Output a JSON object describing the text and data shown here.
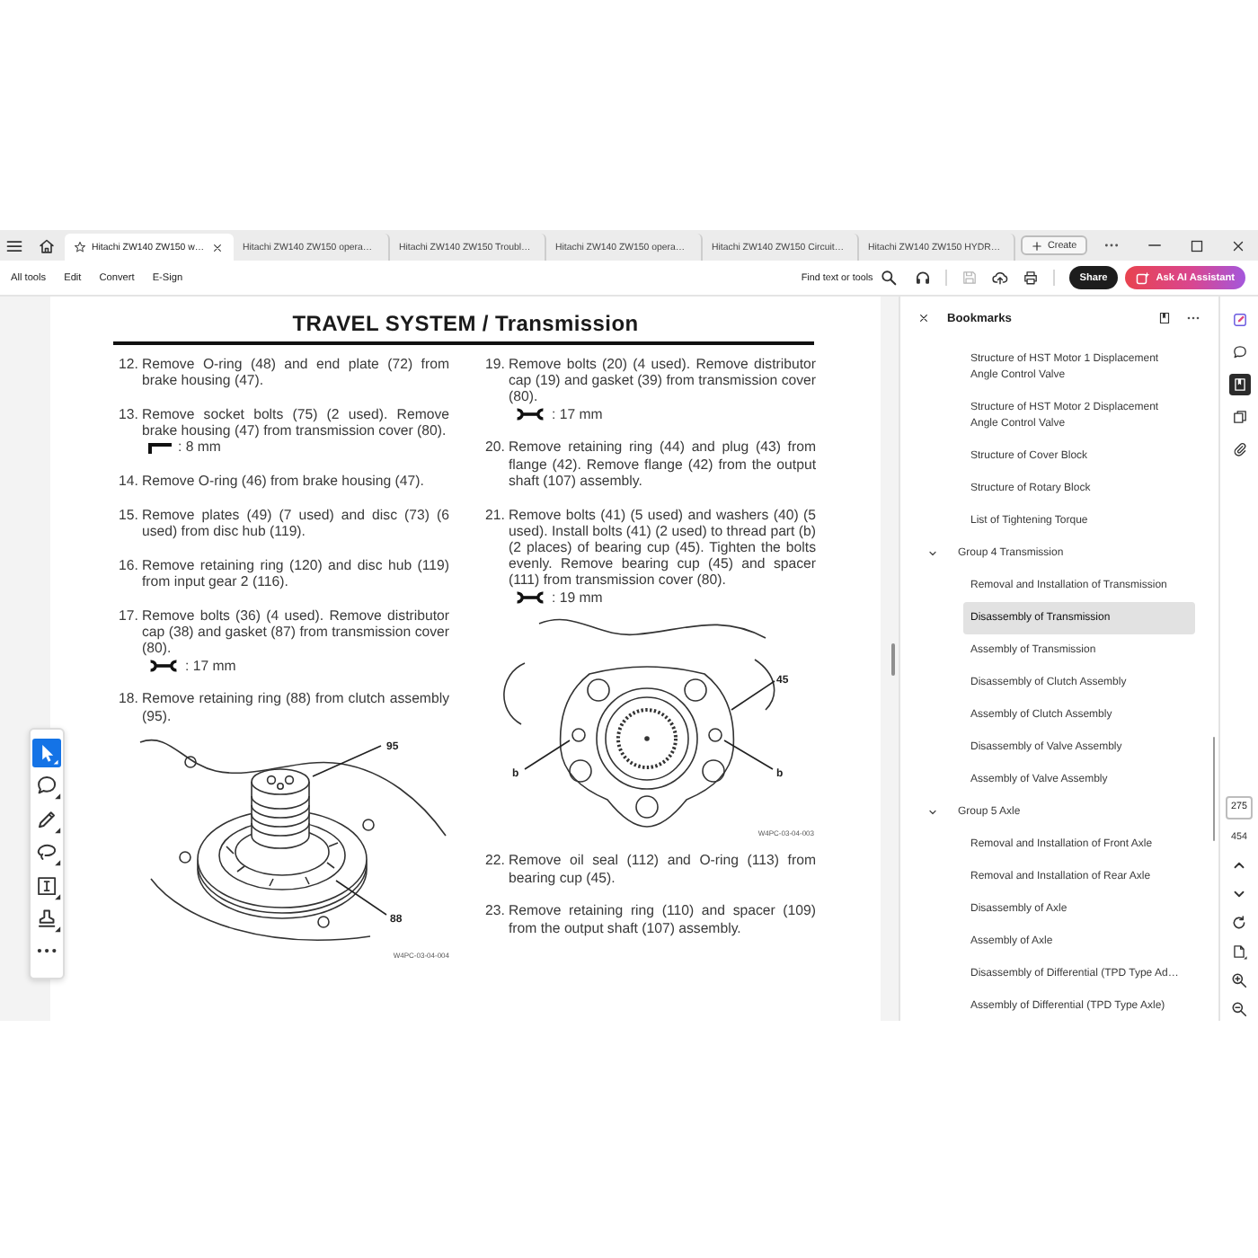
{
  "tabs": [
    {
      "title": "Hitachi ZW140 ZW150 w…",
      "selected": true
    },
    {
      "title": "Hitachi ZW140 ZW150 opera…",
      "selected": false
    },
    {
      "title": "Hitachi ZW140 ZW150 Troubl…",
      "selected": false
    },
    {
      "title": "Hitachi ZW140 ZW150 opera…",
      "selected": false
    },
    {
      "title": "Hitachi ZW140 ZW150 Circuit…",
      "selected": false
    },
    {
      "title": "Hitachi ZW140 ZW150 HYDR…",
      "selected": false
    }
  ],
  "create_button": "Create",
  "menu": [
    "All tools",
    "Edit",
    "Convert",
    "E-Sign"
  ],
  "find": "Find text or tools",
  "toolbar_icons": [
    {
      "kind": "listen",
      "disabled": false
    },
    {
      "kind": "save",
      "disabled": true
    },
    {
      "kind": "upload",
      "disabled": false
    },
    {
      "kind": "print",
      "disabled": false
    }
  ],
  "share": "Share",
  "ai_assistant": "Ask AI Assistant",
  "document": {
    "title": "TRAVEL SYSTEM / Transmission",
    "columns": [
      {
        "blocks": [
          {
            "kind": "step",
            "number": "12.",
            "text": "Remove O-ring (48) and end plate (72) from brake housing (47)."
          },
          {
            "kind": "step",
            "number": "13.",
            "text": "Remove socket bolts (75) (2 used). Remove brake housing (47) from transmission cover (80).",
            "tool": {
              "kind": "hex_key",
              "size": ": 8 mm"
            }
          },
          {
            "kind": "step",
            "number": "14.",
            "text": "Remove O-ring (46) from brake housing (47)."
          },
          {
            "kind": "step",
            "number": "15.",
            "text": "Remove plates (49) (7 used) and disc (73) (6 used) from disc hub (119)."
          },
          {
            "kind": "step",
            "number": "16.",
            "text": "Remove retaining ring (120) and disc hub (119) from input gear 2 (116)."
          },
          {
            "kind": "step",
            "number": "17.",
            "text": "Remove bolts (36) (4 used). Remove distributor cap (38) and gasket (87) from transmission cover (80).",
            "tool": {
              "kind": "wrench",
              "size": ": 17 mm"
            }
          },
          {
            "kind": "step",
            "number": "18.",
            "text": "Remove retaining ring (88) from clutch assembly (95)."
          },
          {
            "kind": "clutch",
            "labels": [
              "95",
              "88"
            ],
            "caption": "W4PC-03-04-004"
          }
        ]
      },
      {
        "blocks": [
          {
            "kind": "step",
            "number": "19.",
            "text": "Remove bolts (20) (4 used). Remove distributor cap (19) and gasket (39) from transmission cover (80).",
            "tool": {
              "kind": "wrench",
              "size": ": 17 mm"
            }
          },
          {
            "kind": "step",
            "number": "20.",
            "text": "Remove retaining ring (44) and plug (43) from flange (42). Remove flange (42) from the output shaft (107) assembly."
          },
          {
            "kind": "step",
            "number": "21.",
            "text": "Remove bolts (41) (5 used) and washers (40) (5 used). Install bolts (41) (2 used) to thread part (b) (2 places) of bearing cup (45). Tighten the bolts evenly. Remove bearing cup (45) and spacer (111) from transmission cover (80).",
            "tool": {
              "kind": "wrench",
              "size": ": 19 mm"
            }
          },
          {
            "kind": "flange",
            "labels": [
              "45",
              "b",
              "b"
            ],
            "caption": "W4PC-03-04-003"
          },
          {
            "kind": "step",
            "number": "22.",
            "text": "Remove oil seal (112) and O-ring (113) from bearing cup (45)."
          },
          {
            "kind": "step",
            "number": "23.",
            "text": "Remove retaining ring (110) and spacer (109) from the output shaft (107) assembly."
          }
        ]
      }
    ]
  },
  "side_tools": [
    {
      "kind": "select",
      "selected": true
    },
    {
      "kind": "comment",
      "selected": false
    },
    {
      "kind": "pen",
      "selected": false
    },
    {
      "kind": "lasso",
      "selected": false
    },
    {
      "kind": "textbox",
      "selected": false
    },
    {
      "kind": "stamp",
      "selected": false
    },
    {
      "kind": "more",
      "selected": false
    }
  ],
  "bookmarks": {
    "title": "Bookmarks",
    "items": [
      {
        "children": [
          {
            "label": "Structure of HST Motor 1 Displacement Angle Control Valve",
            "selected": false
          },
          {
            "label": "Structure of HST Motor 2 Displacement Angle Control Valve",
            "selected": false
          },
          {
            "label": "Structure of Cover Block",
            "selected": false
          },
          {
            "label": "Structure of Rotary Block",
            "selected": false
          },
          {
            "label": "List of Tightening Torque",
            "selected": false
          }
        ]
      },
      {
        "label": "Group 4 Transmission",
        "selected": false,
        "expanded": true,
        "children": [
          {
            "label": "Removal and Installation of Transmission",
            "selected": false
          },
          {
            "label": "Disassembly of Transmission",
            "selected": true
          },
          {
            "label": "Assembly of Transmission",
            "selected": false
          },
          {
            "label": "Disassembly of Clutch Assembly",
            "selected": false
          },
          {
            "label": "Assembly of Clutch Assembly",
            "selected": false
          },
          {
            "label": "Disassembly of Valve Assembly",
            "selected": false
          },
          {
            "label": "Assembly of Valve Assembly",
            "selected": false
          }
        ]
      },
      {
        "label": "Group 5 Axle",
        "selected": false,
        "expanded": true,
        "children": [
          {
            "label": "Removal and Installation of Front Axle",
            "selected": false
          },
          {
            "label": "Removal and Installation of Rear Axle",
            "selected": false
          },
          {
            "label": "Disassembly of Axle",
            "selected": false
          },
          {
            "label": "Assembly of Axle",
            "selected": false
          },
          {
            "label": "Disassembly of Differential (TPD Type Ad…",
            "selected": false
          },
          {
            "label": "Assembly of Differential (TPD Type Axle)",
            "selected": false
          }
        ]
      }
    ]
  },
  "rail_tools": [
    {
      "kind": "edit",
      "selected": false
    },
    {
      "kind": "comment",
      "selected": false
    },
    {
      "kind": "bookmarks",
      "selected": true
    },
    {
      "kind": "pages",
      "selected": false
    },
    {
      "kind": "attach",
      "selected": false
    }
  ],
  "page_nav": {
    "page": "275",
    "total": "454"
  }
}
